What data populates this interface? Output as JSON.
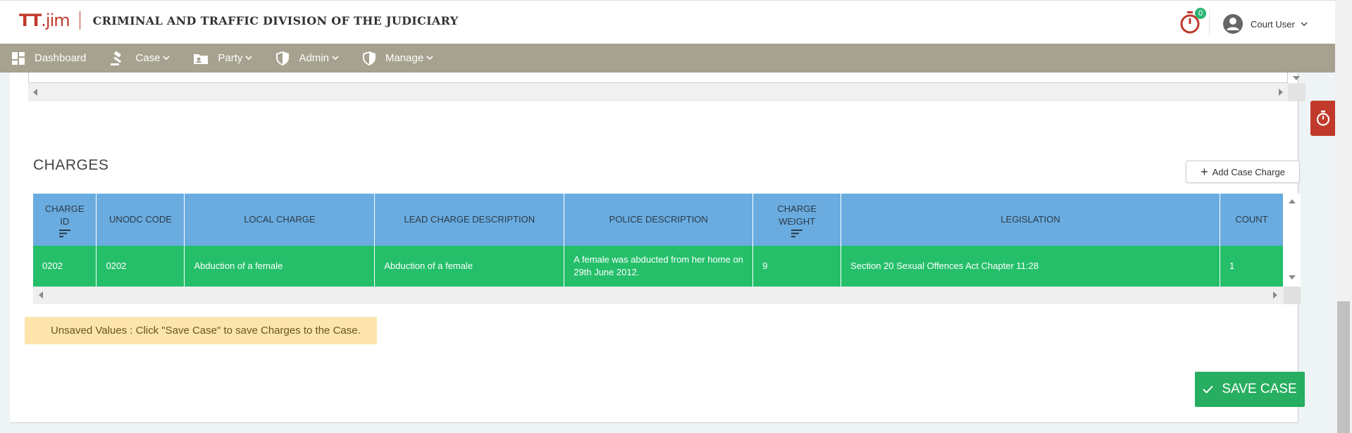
{
  "header": {
    "logo": {
      "prefix": "TT",
      "suffix": ".jim"
    },
    "title": "CRIMINAL AND TRAFFIC DIVISION OF THE JUDICIARY",
    "timer_badge": "0",
    "user_name": "Court User"
  },
  "nav": {
    "items": [
      {
        "label": "Dashboard",
        "icon": "dashboard-icon"
      },
      {
        "label": "Case",
        "icon": "gavel-icon"
      },
      {
        "label": "Party",
        "icon": "contact-card-icon"
      },
      {
        "label": "Admin",
        "icon": "shield-icon"
      },
      {
        "label": "Manage",
        "icon": "shield-icon"
      }
    ]
  },
  "charges": {
    "title": "CHARGES",
    "add_button": "Add Case Charge",
    "columns": {
      "charge_id": [
        "CHARGE",
        "ID"
      ],
      "unodc": "UNODC CODE",
      "local": "LOCAL CHARGE",
      "lead": "LEAD CHARGE DESCRIPTION",
      "police": "POLICE DESCRIPTION",
      "weight": [
        "CHARGE",
        "WEIGHT"
      ],
      "legislation": "LEGISLATION",
      "count": "COUNT"
    },
    "rows": [
      {
        "charge_id": "0202",
        "unodc": "0202",
        "local": "Abduction of a female",
        "lead": "Abduction of a female",
        "police": "A female was abducted from her home on 29th June 2012.",
        "weight": "9",
        "legislation": "Section 20 Sexual Offences Act Chapter 11:28",
        "count": "1"
      }
    ]
  },
  "notice": "Unsaved Values : Click \"Save Case\" to save Charges to the Case.",
  "save_button": "SAVE CASE",
  "colors": {
    "nav_bg": "#a6a28f",
    "header_row": "#6aace0",
    "selected_row": "#25bf6a",
    "notice_bg": "#fde4ad",
    "save_bg": "#27ae60",
    "brand_red": "#c0392b"
  }
}
